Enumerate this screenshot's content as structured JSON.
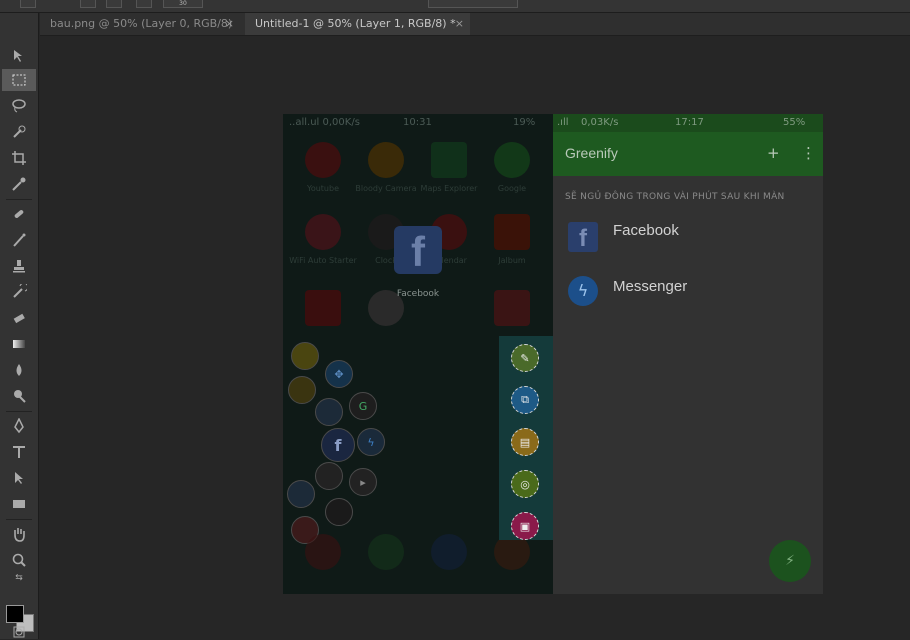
{
  "tabs": [
    {
      "label": "bau.png @ 50% (Layer 0, RGB/8)",
      "close": "×"
    },
    {
      "label": "Untitled-1 @ 50% (Layer 1, RGB/8) *",
      "close": "×"
    }
  ],
  "toolbar": {
    "zoom_value": "30"
  },
  "phone_left": {
    "status_left": "..all.ul 0,00K/s",
    "status_time": "10:31",
    "status_right": "19%",
    "home_labels": [
      "Youtube",
      "Bloody Camera",
      "Maps Explorer",
      "Google",
      "WiFi Auto Starter",
      "Clock",
      "Calendar",
      "Jalbum"
    ],
    "facebook_drag_label": "Facebook",
    "facebook_glyph": "f"
  },
  "phone_right": {
    "status_speed": "0,03K/s",
    "status_time": "17:17",
    "status_battery": "55%",
    "app_title": "Greenify",
    "add_icon": "+",
    "menu_icon": "⋮",
    "section_header": "SẼ NGỦ ĐÔNG TRONG VÀI PHÚT SAU KHI MÀN",
    "apps": [
      {
        "name": "Facebook",
        "icon": "facebook-icon"
      },
      {
        "name": "Messenger",
        "icon": "messenger-icon"
      }
    ],
    "fab_icon": "zzz-icon"
  },
  "colors": {
    "greenify_bar": "#1e5a20",
    "panel": "#143a3a",
    "canvas": "#262626"
  }
}
